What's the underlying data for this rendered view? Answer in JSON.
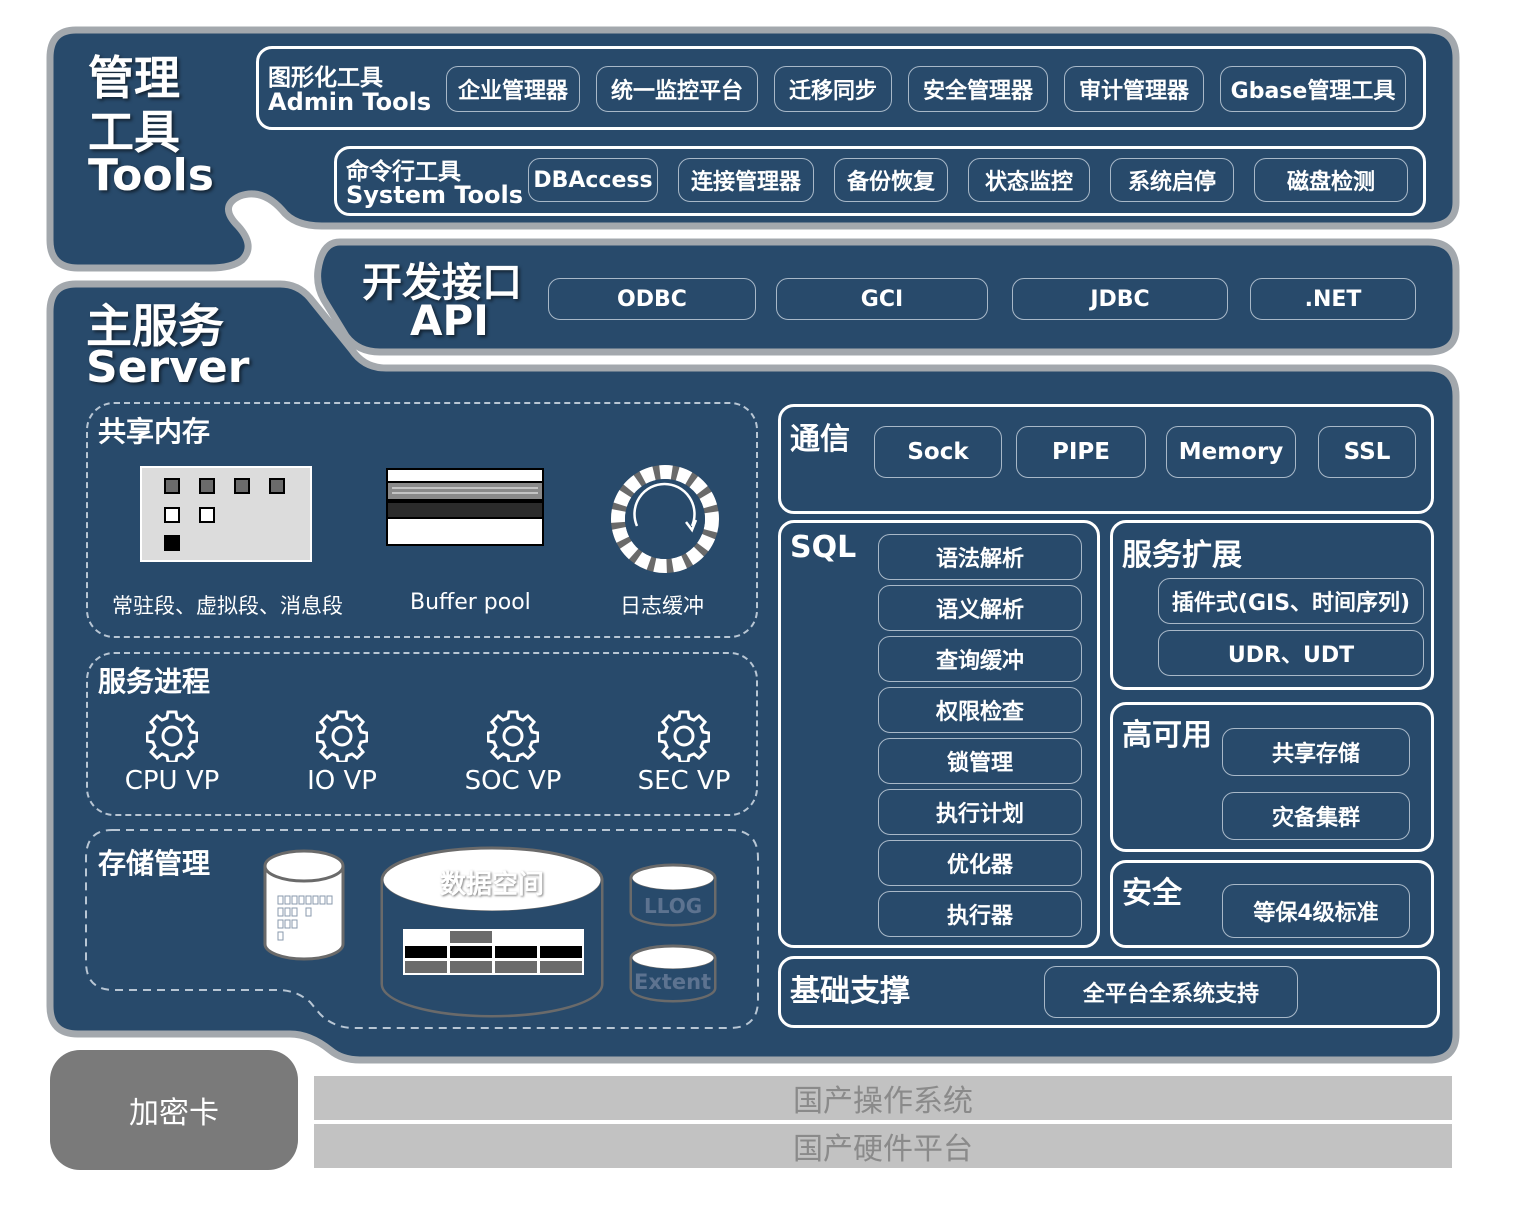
{
  "tools": {
    "title_cn": "管理",
    "title_cn2": "工具",
    "title_en": "Tools",
    "admin": {
      "label_cn": "图形化工具",
      "label_en": "Admin Tools",
      "items": [
        "企业管理器",
        "统一监控平台",
        "迁移同步",
        "安全管理器",
        "审计管理器",
        "Gbase管理工具"
      ]
    },
    "system": {
      "label_cn": "命令行工具",
      "label_en": "System Tools",
      "items": [
        "DBAccess",
        "连接管理器",
        "备份恢复",
        "状态监控",
        "系统启停",
        "磁盘检测"
      ]
    }
  },
  "api": {
    "title_cn": "开发接口",
    "title_en": "API",
    "items": [
      "ODBC",
      "GCI",
      "JDBC",
      ".NET"
    ]
  },
  "server": {
    "title_cn": "主服务",
    "title_en": "Server",
    "shared_memory": {
      "title": "共享内存",
      "labels": [
        "常驻段、虚拟段、消息段",
        "Buffer pool",
        "日志缓冲"
      ]
    },
    "processes": {
      "title": "服务进程",
      "items": [
        "CPU VP",
        "IO VP",
        "SOC VP",
        "SEC VP"
      ]
    },
    "storage": {
      "title": "存储管理",
      "data_space": "数据空间",
      "llog": "LLOG",
      "extent": "Extent"
    },
    "comm": {
      "title": "通信",
      "items": [
        "Sock",
        "PIPE",
        "Memory",
        "SSL"
      ]
    },
    "sql": {
      "title": "SQL",
      "items": [
        "语法解析",
        "语义解析",
        "查询缓冲",
        "权限检查",
        "锁管理",
        "执行计划",
        "优化器",
        "执行器"
      ]
    },
    "ext": {
      "title": "服务扩展",
      "items": [
        "插件式(GIS、时间序列)",
        "UDR、UDT"
      ]
    },
    "ha": {
      "title": "高可用",
      "items": [
        "共享存储",
        "灾备集群"
      ]
    },
    "security": {
      "title": "安全",
      "item": "等保4级标准"
    },
    "base": {
      "title": "基础支撑",
      "item": "全平台全系统支持"
    }
  },
  "bottom": {
    "card": "加密卡",
    "os": "国产操作系统",
    "hw": "国产硬件平台"
  },
  "colors": {
    "panel": "#284a6b",
    "panel_shadow": "#9ea3a8",
    "card": "#7a7a7a",
    "platform": "#c2c2c2",
    "platform_text": "#8a8a8a"
  }
}
